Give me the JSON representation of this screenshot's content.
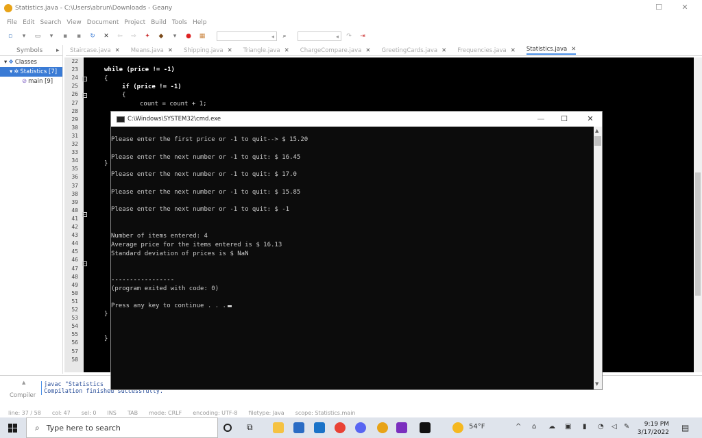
{
  "window": {
    "title": "Statistics.java - C:\\Users\\abrun\\Downloads - Geany"
  },
  "menu": [
    "File",
    "Edit",
    "Search",
    "View",
    "Document",
    "Project",
    "Build",
    "Tools",
    "Help"
  ],
  "sidebar": {
    "tab_label": "Symbols",
    "classes_label": "Classes",
    "class_item": "Statistics [7]",
    "method_item": "main [9]"
  },
  "doc_tabs": [
    "Staircase.java",
    "Means.java",
    "Shipping.java",
    "Triangle.java",
    "ChargeCompare.java",
    "GreetingCards.java",
    "Frequencies.java",
    "Statistics.java"
  ],
  "editor": {
    "line_numbers": [
      "22",
      "23",
      "24",
      "25",
      "26",
      "27",
      "28",
      "29",
      "30",
      "31",
      "32",
      "33",
      "34",
      "35",
      "36",
      "37",
      "38",
      "39",
      "40",
      "41",
      "42",
      "43",
      "44",
      "45",
      "46",
      "47",
      "48",
      "49",
      "50",
      "51",
      "52",
      "53",
      "54",
      "55",
      "56",
      "57",
      "58"
    ],
    "code_while": "while (price != -1)",
    "code_brace1": "{",
    "code_if": "if (price != -1)",
    "code_brace2": "{",
    "code_count": "count = count + 1;",
    "code_close_brace_a": "}",
    "code_close_brace_b": "}",
    "code_close_brace_c": "}"
  },
  "console": {
    "title": "C:\\Windows\\SYSTEM32\\cmd.exe",
    "lines": [
      "Please enter the first price or -1 to quit--> $ 15.20",
      "Please enter the next number or -1 to quit: $ 16.45",
      "Please enter the next number or -1 to quit: $ 17.0",
      "Please enter the next number or -1 to quit: $ 15.85",
      "Please enter the next number or -1 to quit: $ -1",
      "Number of items entered: 4",
      "Average price for the items entered is $ 16.13",
      "Standard deviation of prices is $ NaN",
      "-----------------",
      "(program exited with code: 0)",
      "Press any key to continue . . ."
    ]
  },
  "messages": {
    "tab_label": "Compiler",
    "line1": "javac \"Statistics",
    "line2": "Compilation finished successfully."
  },
  "status": {
    "line": "line: 37 / 58",
    "col": "col: 47",
    "sel": "sel: 0",
    "ins": "INS",
    "tab": "TAB",
    "mode": "mode: CRLF",
    "encoding": "encoding: UTF-8",
    "filetype": "filetype: Java",
    "scope": "scope: Statistics.main"
  },
  "taskbar": {
    "search_placeholder": "Type here to search",
    "weather": "54°F",
    "time": "9:19 PM",
    "date": "3/17/2022"
  }
}
